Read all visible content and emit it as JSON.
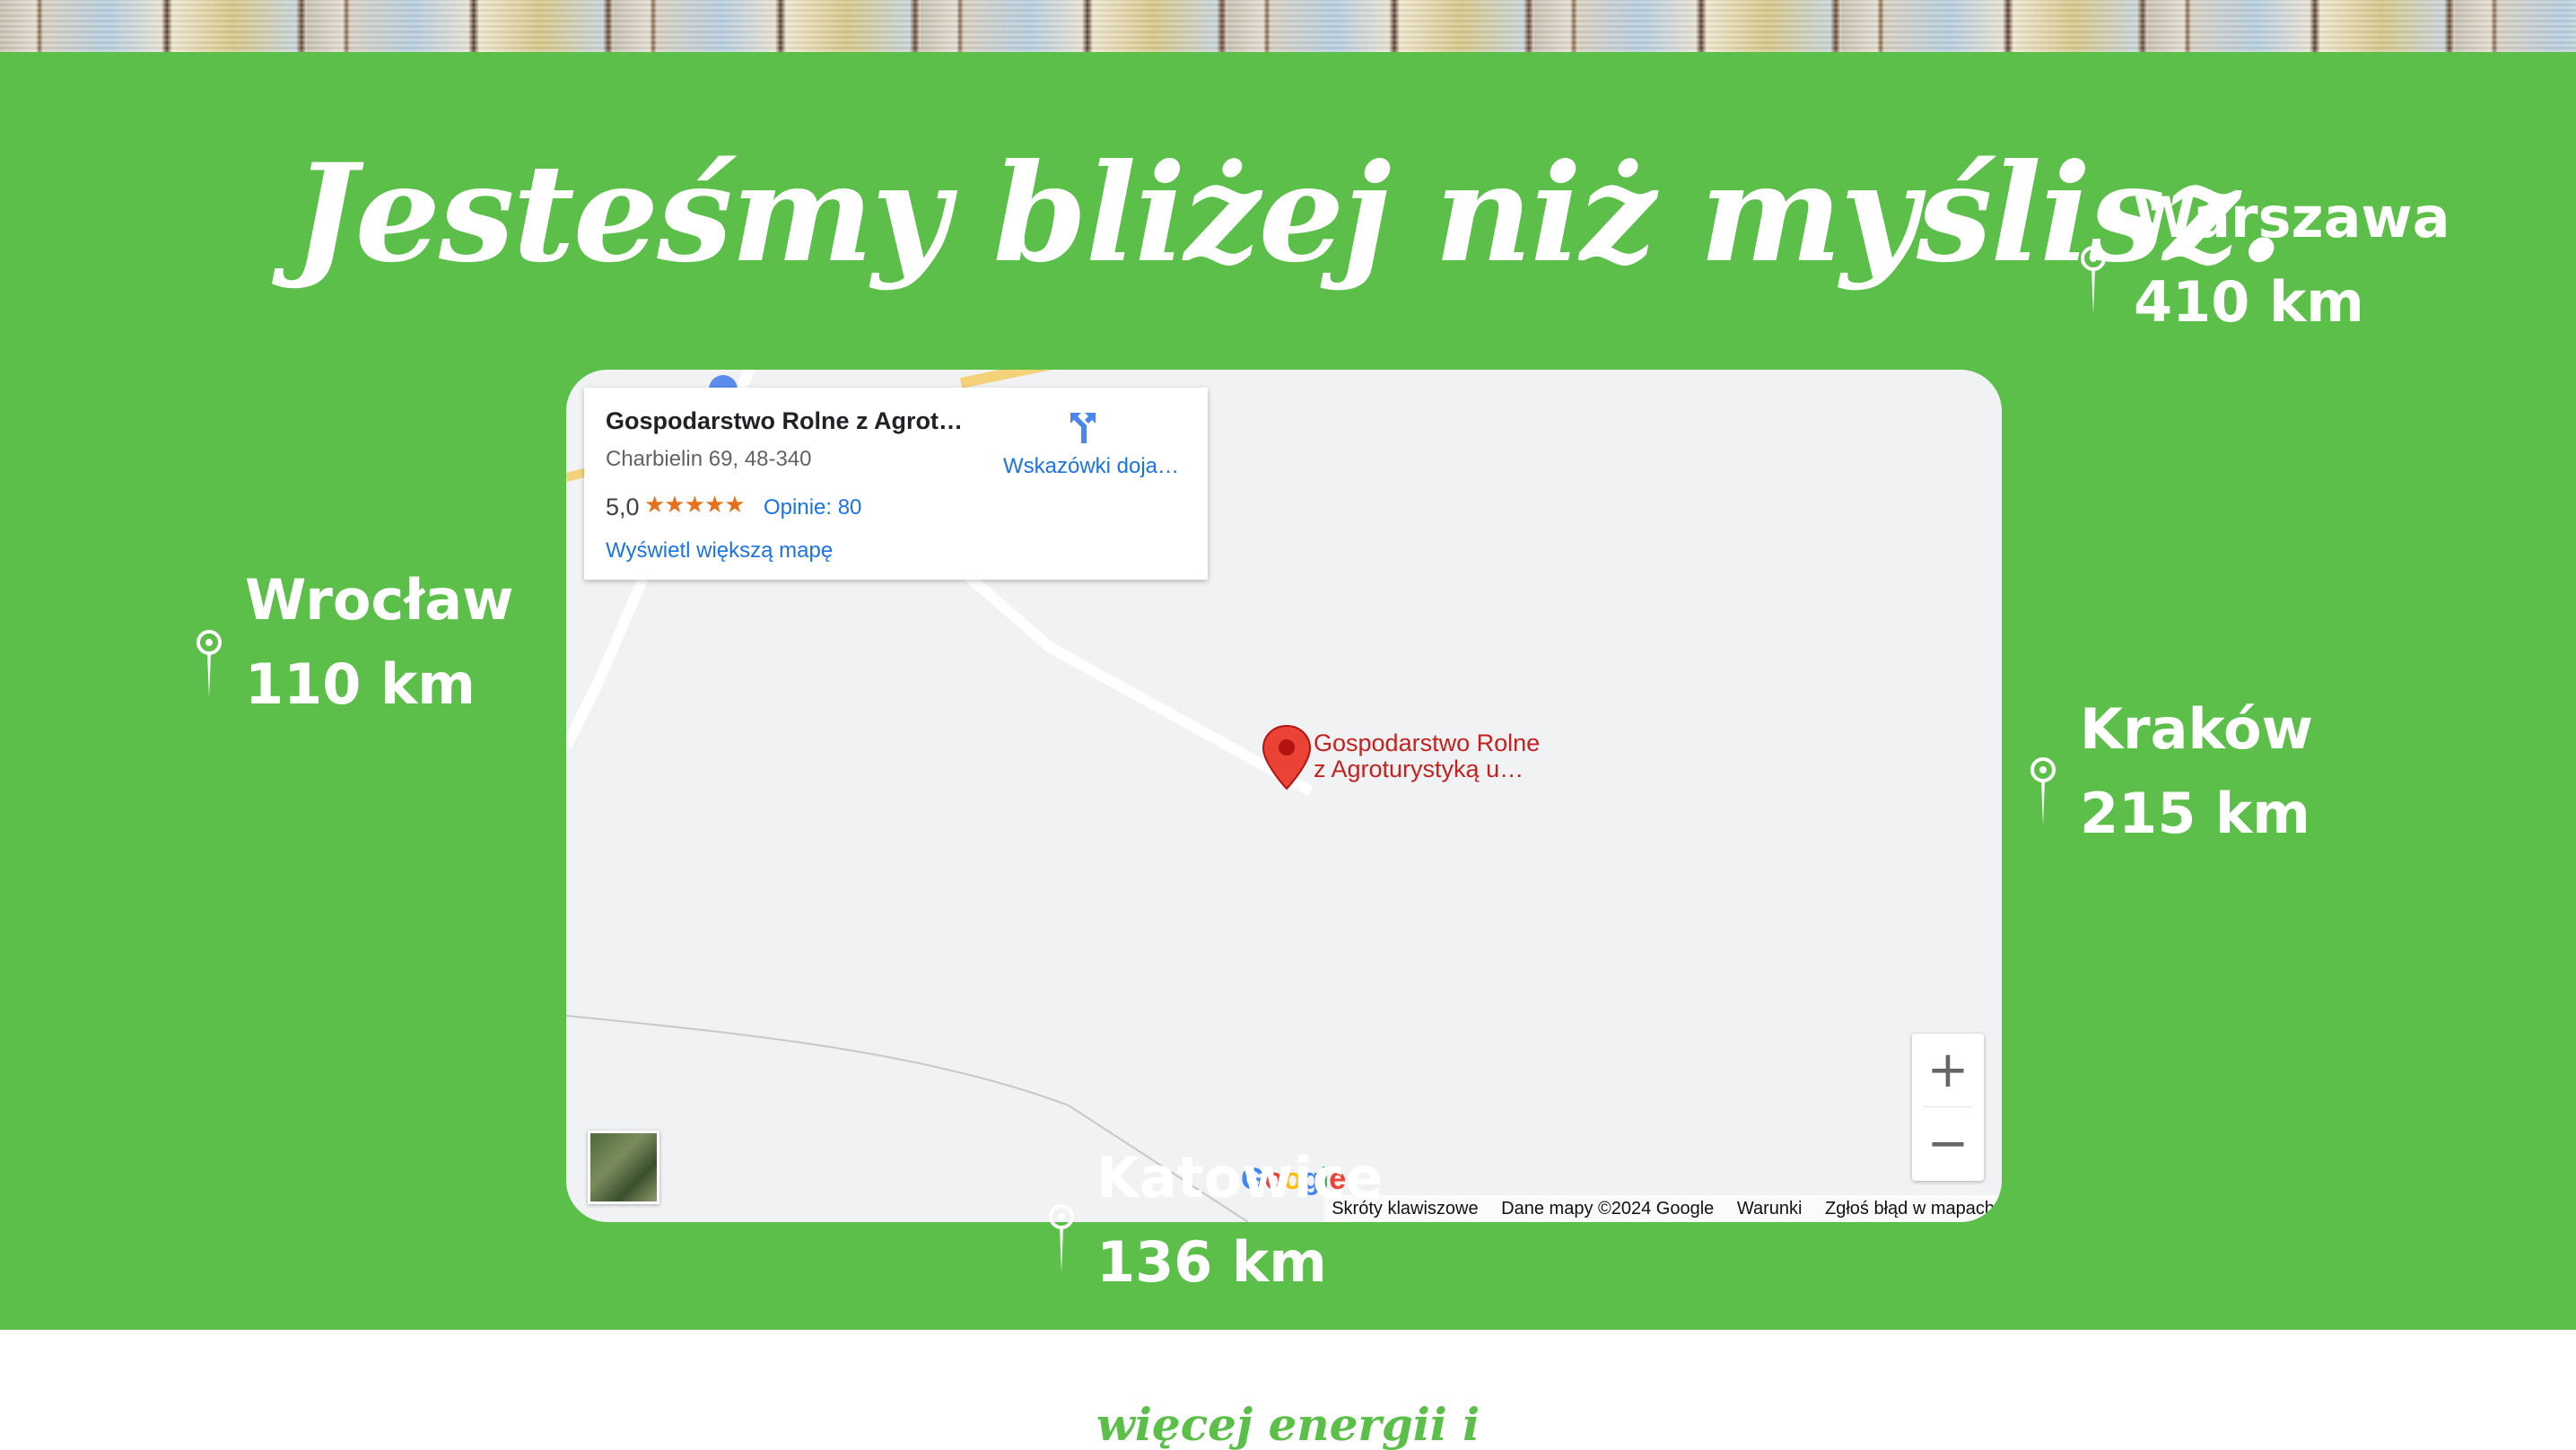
{
  "headline": "Jesteśmy bliżej niż myślisz.",
  "cities": {
    "warszawa": {
      "name": "Warszawa",
      "distance": "410 km"
    },
    "wroclaw": {
      "name": "Wrocław",
      "distance": "110 km"
    },
    "krakow": {
      "name": "Kraków",
      "distance": "215 km"
    },
    "katowice": {
      "name": "Katowice",
      "distance": "136 km"
    }
  },
  "map": {
    "place_card": {
      "title": "Gospodarstwo Rolne z Agrotu…",
      "address": "Charbielin 69, 48-340",
      "rating": "5,0",
      "stars": "★★★★★",
      "reviews": "Opinie: 80",
      "directions_label": "Wskazówki doja…",
      "bigger_map_link": "Wyświetl większą mapę"
    },
    "marker_label_line1": "Gospodarstwo Rolne",
    "marker_label_line2": "z Agroturystyką u…",
    "zoom_in": "+",
    "zoom_out": "−",
    "logo_text": "Google",
    "attribution": {
      "shortcuts": "Skróty klawiszowe",
      "map_data": "Dane mapy ©2024 Google",
      "terms": "Warunki",
      "report": "Zgłoś błąd w mapach"
    }
  },
  "bottom_teaser": "więcej energii i",
  "colors": {
    "green": "#5cbf4a",
    "white": "#ffffff",
    "map_bg": "#f1f2f4",
    "link_blue": "#1a73e8",
    "marker_red": "#c5221f"
  }
}
